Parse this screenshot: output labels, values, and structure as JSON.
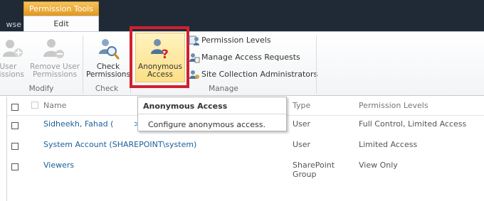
{
  "ribbon": {
    "context_group": "Permission Tools",
    "tab_browse": "wse",
    "tab_edit": "Edit"
  },
  "groups": {
    "modify": {
      "label": "Modify",
      "grant_user_1": "t User",
      "grant_user_2": "nissions",
      "remove_user_1": "Remove User",
      "remove_user_2": "Permissions"
    },
    "check": {
      "label": "Check",
      "check_1": "Check",
      "check_2": "Permissions"
    },
    "manage": {
      "label": "Manage",
      "anon_1": "Anonymous",
      "anon_2": "Access",
      "permission_levels": "Permission Levels",
      "manage_access_requests": "Manage Access Requests",
      "site_collection_admins": "Site Collection Administrators"
    }
  },
  "tooltip": {
    "title": "Anonymous Access",
    "description": "Configure anonymous access."
  },
  "list": {
    "headers": {
      "name": "Name",
      "type": "Type",
      "permission_levels": "Permission Levels"
    },
    "rows": [
      {
        "name": "Sidheekh, Fahad (",
        "type": "User",
        "levels": "Full Control, Limited Access"
      },
      {
        "name": "System Account (SHAREPOINT\\system)",
        "type": "User",
        "levels": "Limited Access"
      },
      {
        "name": "Viewers",
        "type_1": "SharePoint",
        "type_2": "Group",
        "levels": "View Only"
      }
    ]
  },
  "icons": {
    "grant": "user-add-icon",
    "remove": "user-remove-icon",
    "check": "user-magnifier-icon",
    "anonymous": "anonymous-user-icon",
    "permission_levels": "permission-levels-icon",
    "access_requests": "access-requests-icon",
    "site_admins": "site-admins-icon"
  },
  "colors": {
    "highlight": "#d1202d",
    "context_tab": "#e49a22",
    "link": "#1a5e9a"
  }
}
